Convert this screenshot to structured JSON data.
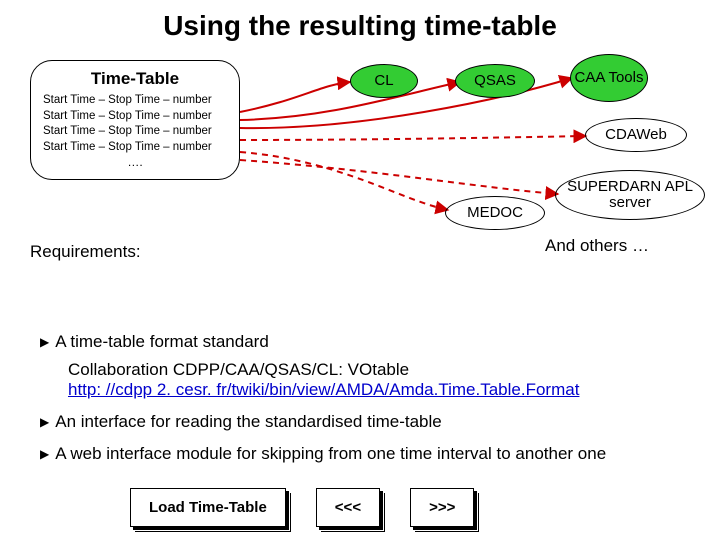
{
  "title": "Using the resulting time-table",
  "timetable": {
    "heading": "Time-Table",
    "rows": [
      "Start Time – Stop Time – number",
      "Start Time – Stop Time – number",
      "Start Time – Stop Time – number",
      "Start Time – Stop Time – number"
    ],
    "ellipsis": "…."
  },
  "nodes": {
    "cl": "CL",
    "qsas": "QSAS",
    "caa": "CAA Tools",
    "cdaweb": "CDAWeb",
    "medoc": "MEDOC",
    "superdarn": "SUPERDARN APL server"
  },
  "requirements_label": "Requirements:",
  "and_others": "And others …",
  "bullets": {
    "b1": "A time-table format standard",
    "collab": "Collaboration CDPP/CAA/QSAS/CL: VOtable",
    "link": "http: //cdpp 2. cesr. fr/twiki/bin/view/AMDA/Amda.Time.Table.Format",
    "b2": "An interface for reading the standardised time-table",
    "b3": "A web interface module for skipping from one time interval to another one"
  },
  "buttons": {
    "load": "Load Time-Table",
    "prev": "<<<",
    "next": ">>>"
  }
}
